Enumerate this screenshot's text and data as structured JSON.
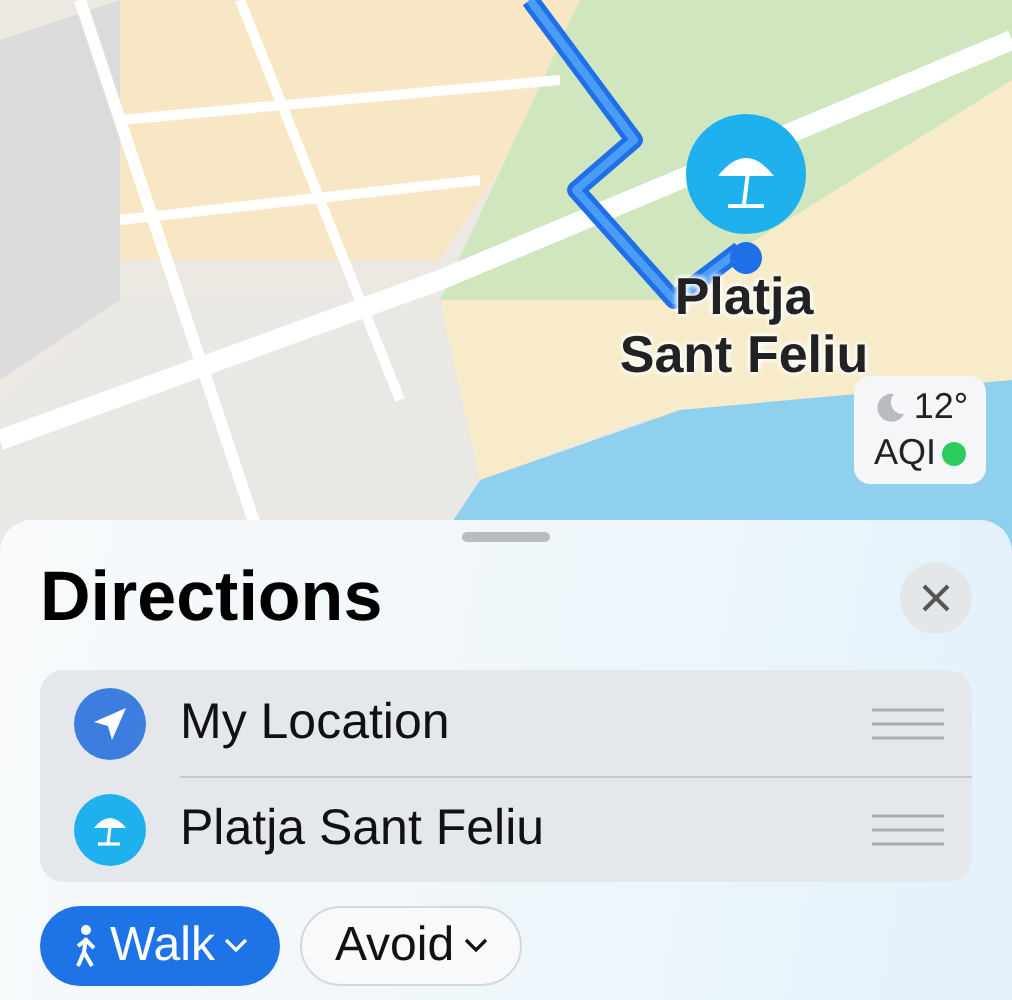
{
  "map": {
    "pin": {
      "label": "Platja Sant Feliu"
    },
    "weather": {
      "temperature": "12°",
      "aqi_label": "AQI"
    }
  },
  "sheet": {
    "title": "Directions",
    "stops": [
      {
        "kind": "current",
        "name": "My Location"
      },
      {
        "kind": "place",
        "name": "Platja Sant Feliu"
      }
    ],
    "options": [
      {
        "kind": "mode",
        "label": "Walk",
        "selected": true
      },
      {
        "kind": "plain",
        "label": "Avoid",
        "selected": false
      }
    ]
  }
}
